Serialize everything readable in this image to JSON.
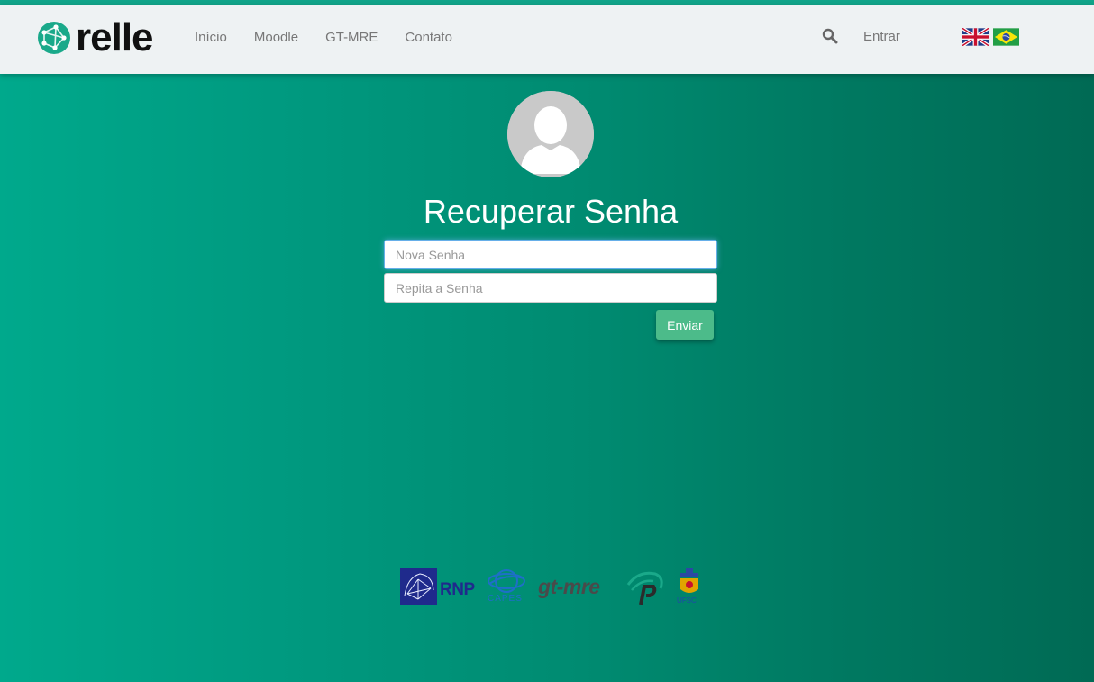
{
  "brand": {
    "name": "relle",
    "accent_color": "#11a58a",
    "bg_from": "#00a98c",
    "bg_to": "#006a54"
  },
  "nav": {
    "links": [
      {
        "label": "Início"
      },
      {
        "label": "Moodle"
      },
      {
        "label": "GT-MRE"
      },
      {
        "label": "Contato"
      }
    ],
    "search_icon": "search-icon",
    "login_label": "Entrar",
    "languages": [
      {
        "code": "en",
        "icon": "uk-flag-icon"
      },
      {
        "code": "pt-BR",
        "icon": "brazil-flag-icon"
      }
    ]
  },
  "form": {
    "title": "Recuperar Senha",
    "new_password_placeholder": "Nova Senha",
    "repeat_password_placeholder": "Repita a Senha",
    "submit_label": "Enviar",
    "submit_color": "#4cbb8a"
  },
  "partners": {
    "rnp_label": "RNP",
    "capes_label": "CAPES",
    "gtmre_label": "gt-mre",
    "ufsc_label": "UFSC"
  }
}
